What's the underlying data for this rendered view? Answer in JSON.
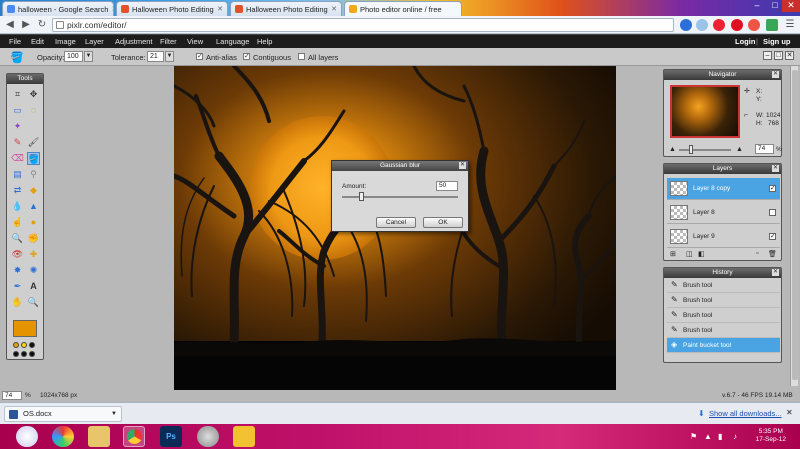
{
  "browser": {
    "tabs": [
      {
        "label": "halloween - Google Search",
        "favicon_color": "#4a8af4"
      },
      {
        "label": "Halloween Photo Editing",
        "favicon_color": "#e0522a"
      },
      {
        "label": "Halloween Photo Editing",
        "favicon_color": "#e0522a"
      },
      {
        "label": "Photo editor online / free",
        "favicon_color": "#f2a81d"
      }
    ],
    "address": "pixlr.com/editor/"
  },
  "menubar": {
    "items": [
      "File",
      "Edit",
      "Image",
      "Layer",
      "Adjustment",
      "Filter",
      "View",
      "Language",
      "Help"
    ],
    "login": "Login",
    "signup": "Sign up"
  },
  "options": {
    "opacity_label": "Opacity:",
    "opacity_value": "100",
    "tolerance_label": "Tolerance:",
    "tolerance_value": "21",
    "antialias_label": "Anti-alias",
    "contiguous_label": "Contiguous",
    "all_layers_label": "All layers"
  },
  "tools_panel": {
    "title": "Tools",
    "foreground_color": "#e69300"
  },
  "dialog": {
    "title": "Gaussian blur",
    "amount_label": "Amount:",
    "amount_value": "50",
    "cancel_label": "Cancel",
    "ok_label": "OK"
  },
  "navigator": {
    "title": "Navigator",
    "x_label": "X:",
    "y_label": "Y:",
    "w_label": "W:",
    "w_value": "1024",
    "h_label": "H:",
    "h_value": "768",
    "zoom_value": "74",
    "zoom_unit": "%"
  },
  "layers": {
    "title": "Layers",
    "items": [
      {
        "name": "Layer 8 copy",
        "checked": true
      },
      {
        "name": "Layer 8",
        "checked": false
      },
      {
        "name": "Layer 9",
        "checked": true
      }
    ]
  },
  "history": {
    "title": "History",
    "items": [
      "Brush tool",
      "Brush tool",
      "Brush tool",
      "Brush tool",
      "Paint bucket tool"
    ]
  },
  "status": {
    "zoom": "74",
    "zoom_unit": "%",
    "size": "1024x768 px",
    "perf": "v.6.7 - 46 FPS 19.14 MB"
  },
  "downloads": {
    "file": "OS.docx",
    "show_all": "Show all downloads..."
  },
  "clock": {
    "time": "5:35 PM",
    "date": "17-Sep-12"
  }
}
